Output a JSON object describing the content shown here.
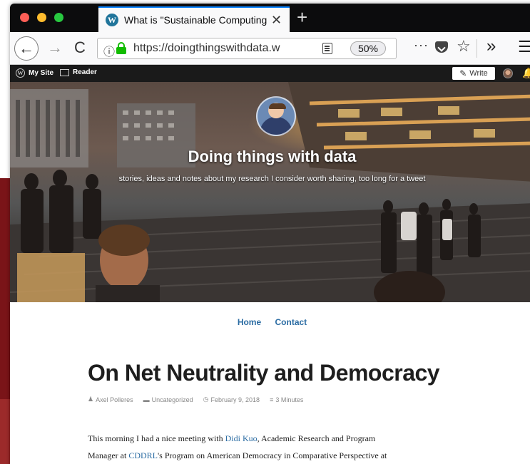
{
  "browser": {
    "tab_title": "What is \"Sustainable Computing",
    "tab_close": "✕",
    "new_tab": "+",
    "url": "https://doingthingswithdata.w",
    "zoom": "50%",
    "more": "···",
    "overflow": "»",
    "menu": "☰"
  },
  "adminbar": {
    "my_site": "My Site",
    "reader": "Reader",
    "write": "Write"
  },
  "site": {
    "title": "Doing things with data",
    "tagline": "stories, ideas and notes about my research I consider worth sharing, too long for a tweet"
  },
  "nav": {
    "items": [
      "Home",
      "Contact"
    ]
  },
  "post": {
    "title": "On Net Neutrality and Democracy",
    "meta": {
      "author": "Axel Polleres",
      "category": "Uncategorized",
      "date": "February 9, 2018",
      "reading_time": "3 Minutes"
    },
    "body": {
      "line1_pre": "This morning I had a nice meeting with ",
      "link1": "Didi Kuo",
      "line1_post": ", Academic Research and Program",
      "line2_pre": "Manager at ",
      "link2": "CDDRL",
      "line2_post": "'s Program on American Democracy in Comparative Perspective at"
    }
  },
  "colors": {
    "tab_accent": "#0a84ff",
    "link": "#2b6ca3",
    "lock_green": "#12bc00"
  },
  "icons": [
    "wordpress-icon",
    "back-icon",
    "forward-icon",
    "reload-icon",
    "info-icon",
    "lock-icon",
    "reader-view-icon",
    "pocket-icon",
    "bookmark-star-icon",
    "hamburger-menu-icon",
    "write-icon",
    "bell-icon"
  ]
}
